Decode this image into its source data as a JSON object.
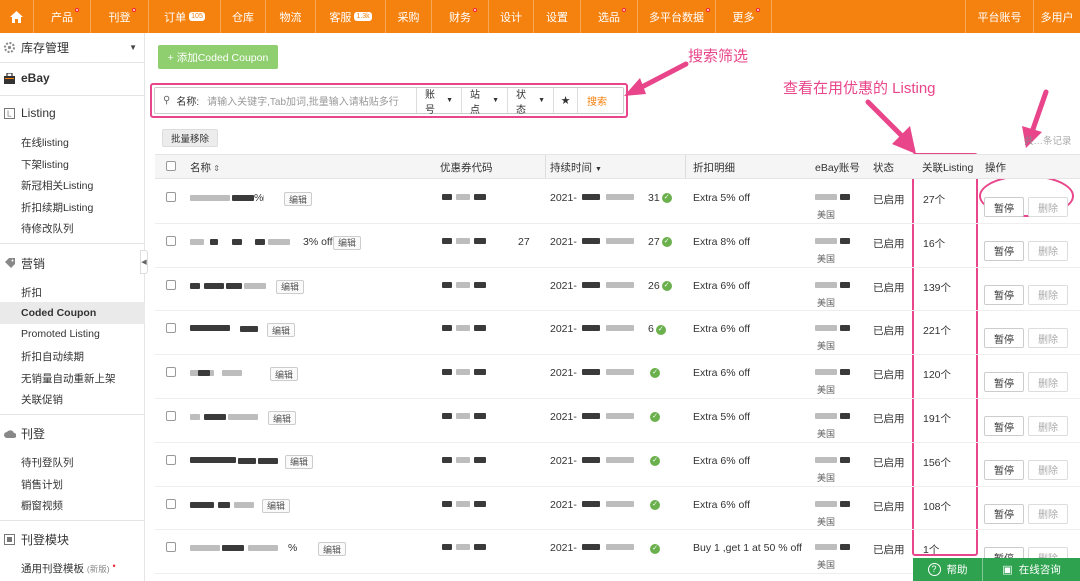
{
  "topnav": {
    "home_icon": "home-icon",
    "items": [
      {
        "label": "产品",
        "dot": true
      },
      {
        "label": "刊登",
        "dot": true
      },
      {
        "label": "订单",
        "badge": "105"
      },
      {
        "label": "仓库"
      },
      {
        "label": "物流"
      },
      {
        "label": "客服",
        "badge": "1.3k"
      },
      {
        "label": "采购"
      },
      {
        "label": "财务",
        "dot": true
      },
      {
        "label": "设计"
      },
      {
        "label": "设置"
      },
      {
        "label": "选品",
        "dot": true
      },
      {
        "label": "多平台数据",
        "dot": true
      },
      {
        "label": "更多",
        "dot": true
      }
    ],
    "right": [
      "平台账号",
      "多用户"
    ]
  },
  "sidebar": {
    "inventory": "库存管理",
    "ebay": "eBay",
    "listing_section": "Listing",
    "listing_items": [
      "在线listing",
      "下架listing",
      "新冠相关Listing",
      "折扣续期Listing",
      "待修改队列"
    ],
    "marketing_section": "营销",
    "marketing_items": [
      "折扣",
      "Coded Coupon",
      "Promoted Listing",
      "折扣自动续期",
      "无销量自动重新上架",
      "关联促销"
    ],
    "publish_section": "刊登",
    "publish_items": [
      "待刊登队列",
      "销售计划",
      "橱窗视频"
    ],
    "module_section": "刊登模块",
    "module_items": [
      "通用刊登模板"
    ],
    "module_new": "(新版)"
  },
  "toolbar": {
    "add_label": "+ 添加Coded Coupon",
    "batch_remove": "批量移除",
    "total_label": "共"
  },
  "search": {
    "name_label": "名称:",
    "placeholder": "请输入关键字,Tab加词,批量输入请粘贴多行",
    "account": "账号",
    "site": "站点",
    "status": "状态",
    "star": "★",
    "search_btn": "搜索"
  },
  "annotations": {
    "search_filter": "搜索筛选",
    "view_listing": "查看在用优惠的 Listing"
  },
  "table": {
    "headers": [
      "名称",
      "优惠券代码",
      "持续时间",
      "折扣明细",
      "eBay账号",
      "状态",
      "关联Listing",
      "操作"
    ],
    "rows": [
      {
        "name_suffix": "%",
        "date": "2021-",
        "date_end": "31",
        "discount": "Extra 5% off",
        "site": "美国",
        "status": "已启用",
        "linked": "27个"
      },
      {
        "name_suffix": "3% off",
        "code_suffix": "27",
        "date": "2021-",
        "date_end": "27",
        "discount": "Extra 8% off",
        "site": "美国",
        "status": "已启用",
        "linked": "16个"
      },
      {
        "name_suffix": "",
        "date": "2021-",
        "date_end": "26",
        "discount": "Extra 6% off",
        "site": "美国",
        "status": "已启用",
        "linked": "139个"
      },
      {
        "name_suffix": "",
        "date": "2021-",
        "date_end": "6",
        "discount": "Extra 6% off",
        "site": "美国",
        "status": "已启用",
        "linked": "221个"
      },
      {
        "name_suffix": "",
        "date": "2021-",
        "date_end": "",
        "discount": "Extra 6% off",
        "site": "美国",
        "status": "已启用",
        "linked": "120个"
      },
      {
        "name_suffix": "",
        "date": "2021-",
        "date_end": "",
        "discount": "Extra 5% off",
        "site": "美国",
        "status": "已启用",
        "linked": "191个"
      },
      {
        "name_suffix": "",
        "date": "2021-",
        "date_end": "",
        "discount": "Extra 6% off",
        "site": "美国",
        "status": "已启用",
        "linked": "156个"
      },
      {
        "name_suffix": "",
        "date": "2021-",
        "date_end": "",
        "discount": "Extra 6% off",
        "site": "美国",
        "status": "已启用",
        "linked": "108个"
      },
      {
        "name_suffix": "%",
        "date": "2021-",
        "date_end": "",
        "discount": "Buy 1 ,get 1 at 50 % off",
        "site": "美国",
        "status": "已启用",
        "linked": "1个"
      }
    ],
    "edit_label": "编辑",
    "pause_label": "暂停",
    "delete_label": "删除"
  },
  "help": {
    "help_label": "帮助",
    "chat_label": "在线咨询"
  },
  "colors": {
    "brand": "#f5820f",
    "annotation": "#e8458a",
    "add_button": "#8fcf6f",
    "help_bar": "#2ea24f"
  }
}
